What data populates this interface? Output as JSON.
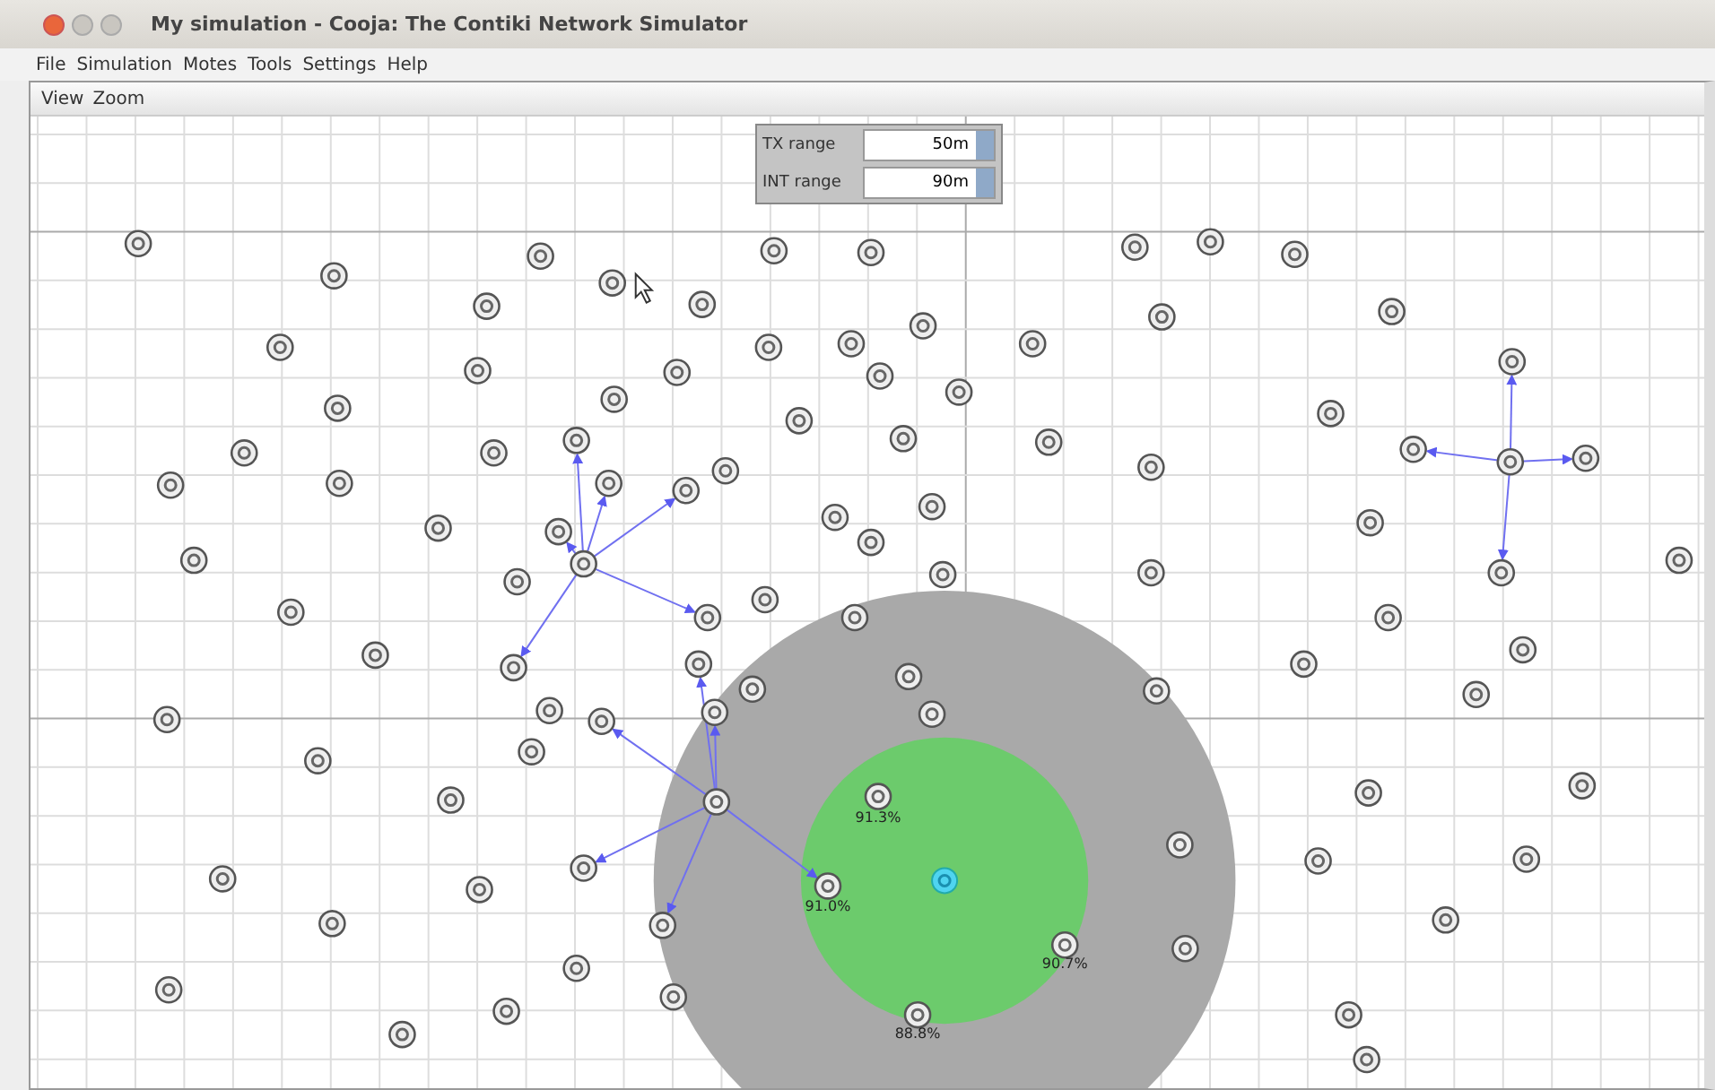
{
  "window": {
    "title": "My simulation - Cooja: The Contiki Network Simulator"
  },
  "menu": [
    "File",
    "Simulation",
    "Motes",
    "Tools",
    "Settings",
    "Help"
  ],
  "view_menu": [
    "View",
    "Zoom"
  ],
  "range_panel": [
    {
      "label": "TX range",
      "value": "50m"
    },
    {
      "label": "INT range",
      "value": "90m"
    }
  ],
  "reception_labels": [
    "91.3%",
    "91.0%",
    "90.7%",
    "88.8%"
  ]
}
